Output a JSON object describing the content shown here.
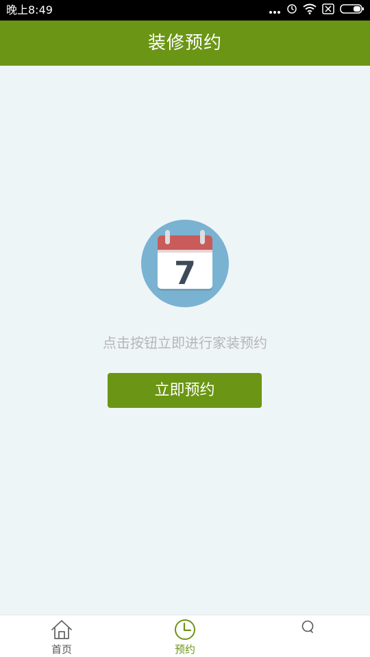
{
  "status_bar": {
    "time": "晚上8:49",
    "icons": [
      "more-dots-icon",
      "alarm-icon",
      "wifi-icon",
      "sim-icon",
      "battery-icon"
    ]
  },
  "header": {
    "title": "装修预约"
  },
  "main": {
    "icon": "calendar-icon",
    "calendar_day": "7",
    "hint": "点击按钮立即进行家装预约",
    "button_label": "立即预约"
  },
  "tab_bar": {
    "tabs": [
      {
        "label": "首页",
        "icon": "home-icon",
        "active": false
      },
      {
        "label": "预约",
        "icon": "clock-icon",
        "active": true
      },
      {
        "label": "",
        "icon": "chat-icon",
        "active": false
      }
    ]
  },
  "colors": {
    "brand_green": "#6b9514",
    "background": "#eef5f7",
    "hint_gray": "#b6b6b6",
    "calendar_circle": "#7ab3d2",
    "calendar_red": "#c95b5b"
  }
}
